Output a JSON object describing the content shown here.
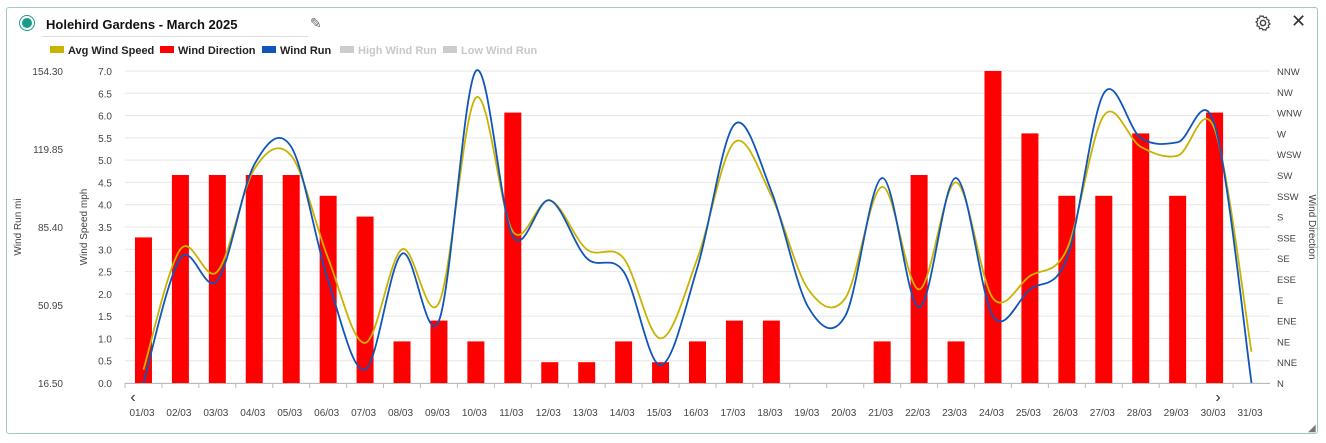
{
  "header": {
    "title": "Holehird Gardens - March 2025",
    "edit_icon": "pencil-icon",
    "settings_icon": "gear-icon",
    "close_label": "✕"
  },
  "colors": {
    "avg": "#c9b300",
    "dir": "#ff0000",
    "run": "#1155bb",
    "disabled": "#cccccc",
    "grid": "#e6e6e6",
    "axis_text": "#444444"
  },
  "nav": {
    "prev": "‹",
    "next": "›"
  },
  "chart_data": {
    "type": "bar+line",
    "categories": [
      "01/03",
      "02/03",
      "03/03",
      "04/03",
      "05/03",
      "06/03",
      "07/03",
      "08/03",
      "09/03",
      "10/03",
      "11/03",
      "12/03",
      "13/03",
      "14/03",
      "15/03",
      "16/03",
      "17/03",
      "18/03",
      "19/03",
      "20/03",
      "21/03",
      "22/03",
      "23/03",
      "24/03",
      "25/03",
      "26/03",
      "27/03",
      "28/03",
      "29/03",
      "30/03",
      "31/03"
    ],
    "legend": [
      {
        "name": "Avg Wind Speed",
        "color": "#c9b300",
        "active": true
      },
      {
        "name": "Wind Direction",
        "color": "#ff0000",
        "active": true
      },
      {
        "name": "Wind Run",
        "color": "#1155bb",
        "active": true
      },
      {
        "name": "High Wind Run",
        "color": "#cccccc",
        "active": false
      },
      {
        "name": "Low Wind Run",
        "color": "#cccccc",
        "active": false
      }
    ],
    "axes": {
      "wind_run": {
        "label": "Wind Run mi",
        "ticks": [
          "154.30",
          "119.85",
          "85.40",
          "50.95",
          "16.50"
        ],
        "range": [
          16.5,
          154.3
        ]
      },
      "wind_speed": {
        "label": "Wind Speed mph",
        "ticks": [
          "7.0",
          "6.5",
          "6.0",
          "5.5",
          "5.0",
          "4.5",
          "4.0",
          "3.5",
          "3.0",
          "2.5",
          "2.0",
          "1.5",
          "1.0",
          "0.5",
          "0.0"
        ],
        "range": [
          0,
          7
        ]
      },
      "wind_direction": {
        "label": "Wind Direction",
        "ticks": [
          "NNW",
          "NW",
          "WNW",
          "W",
          "WSW",
          "SW",
          "SSW",
          "S",
          "SSE",
          "SE",
          "ESE",
          "E",
          "ENE",
          "NE",
          "NNE",
          "N"
        ]
      }
    },
    "series": [
      {
        "name": "Wind Direction",
        "type": "bar",
        "unit": "compass index 0=N..15=NNW",
        "values": [
          7,
          10,
          10,
          10,
          10,
          9,
          8,
          2,
          3,
          2,
          13,
          1,
          1,
          2,
          1,
          2,
          3,
          3,
          null,
          null,
          2,
          10,
          2,
          15,
          12,
          9,
          9,
          12,
          9,
          13,
          null
        ]
      },
      {
        "name": "Avg Wind Speed",
        "type": "line",
        "values": [
          0.3,
          3.0,
          2.5,
          4.8,
          5.1,
          2.8,
          0.9,
          3.0,
          1.8,
          6.4,
          3.4,
          4.1,
          3.0,
          2.8,
          1.0,
          2.8,
          5.4,
          4.2,
          2.1,
          1.9,
          4.4,
          2.1,
          4.5,
          1.9,
          2.4,
          3.0,
          6.0,
          5.3,
          5.1,
          5.7,
          0.7
        ]
      },
      {
        "name": "Wind Run",
        "type": "line",
        "values": [
          0.0,
          2.8,
          2.3,
          4.9,
          5.3,
          2.3,
          0.3,
          2.9,
          1.4,
          7.0,
          3.3,
          4.1,
          2.8,
          2.5,
          0.4,
          2.6,
          5.8,
          4.3,
          1.7,
          1.5,
          4.6,
          1.7,
          4.6,
          1.5,
          2.1,
          2.8,
          6.5,
          5.5,
          5.4,
          5.8,
          0.0
        ]
      }
    ]
  }
}
